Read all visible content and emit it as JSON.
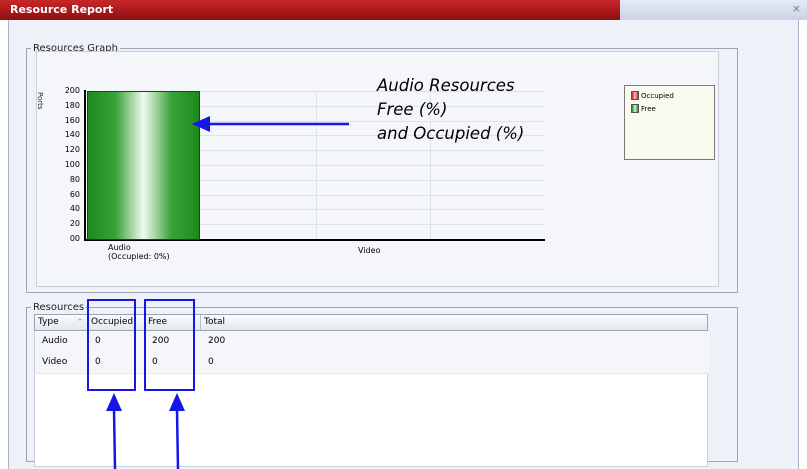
{
  "window": {
    "title": "Resource Report",
    "close_glyph": "×"
  },
  "graph": {
    "group_label": "Resources Graph",
    "annotation": [
      "Audio Resources",
      "Free (%)",
      "and Occupied (%)"
    ],
    "legend": [
      {
        "label": "Occupied",
        "color": "#e83a3a"
      },
      {
        "label": "Free",
        "color": "#2a992a"
      }
    ]
  },
  "chart_data": {
    "type": "bar",
    "ylabel": "Ports",
    "ylim": [
      0,
      200
    ],
    "yticks": [
      "200",
      "180",
      "160",
      "140",
      "120",
      "100",
      "80",
      "60",
      "40",
      "20",
      "00"
    ],
    "categories": [
      "Audio\n(Occupied: 0%)",
      "Video"
    ],
    "series": [
      {
        "name": "Occupied",
        "values": [
          0,
          0
        ],
        "color": "#e83a3a"
      },
      {
        "name": "Free",
        "values": [
          200,
          0
        ],
        "color": "#2a992a"
      }
    ],
    "legend_position": "top-right"
  },
  "resources": {
    "group_label": "Resources",
    "columns": [
      "Type",
      "Occupied",
      "Free",
      "Total"
    ],
    "sort_glyph": "^",
    "rows": [
      [
        "Audio",
        "0",
        "200",
        "200"
      ],
      [
        "Video",
        "0",
        "0",
        "0"
      ]
    ]
  }
}
